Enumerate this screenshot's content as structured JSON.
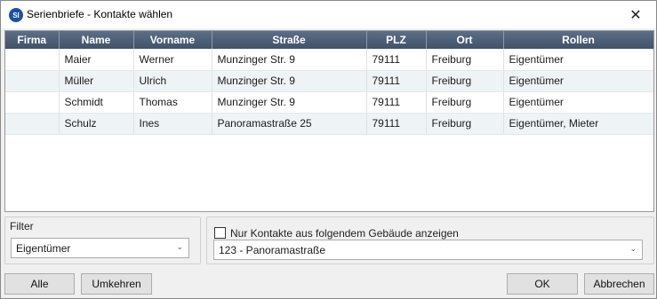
{
  "window": {
    "title": "Serienbriefe - Kontakte wählen",
    "app_icon_text": "SI",
    "close_glyph": "✕"
  },
  "table": {
    "columns": [
      "Firma",
      "Name",
      "Vorname",
      "Straße",
      "PLZ",
      "Ort",
      "Rollen"
    ],
    "rows": [
      [
        "",
        "Maier",
        "Werner",
        "Munzinger Str. 9",
        "79111",
        "Freiburg",
        "Eigentümer"
      ],
      [
        "",
        "Müller",
        "Ulrich",
        "Munzinger Str. 9",
        "79111",
        "Freiburg",
        "Eigentümer"
      ],
      [
        "",
        "Schmidt",
        "Thomas",
        "Munzinger Str. 9",
        "79111",
        "Freiburg",
        "Eigentümer"
      ],
      [
        "",
        "Schulz",
        "Ines",
        "Panoramastraße 25",
        "79111",
        "Freiburg",
        "Eigentümer, Mieter"
      ]
    ]
  },
  "filter": {
    "label": "Filter",
    "selected": "Eigentümer"
  },
  "building": {
    "checkbox_label": "Nur Kontakte aus folgendem Gebäude anzeigen",
    "checked": false,
    "selected": "123 - Panoramastraße"
  },
  "buttons": {
    "all": "Alle",
    "invert": "Umkehren",
    "ok": "OK",
    "cancel": "Abbrechen"
  }
}
